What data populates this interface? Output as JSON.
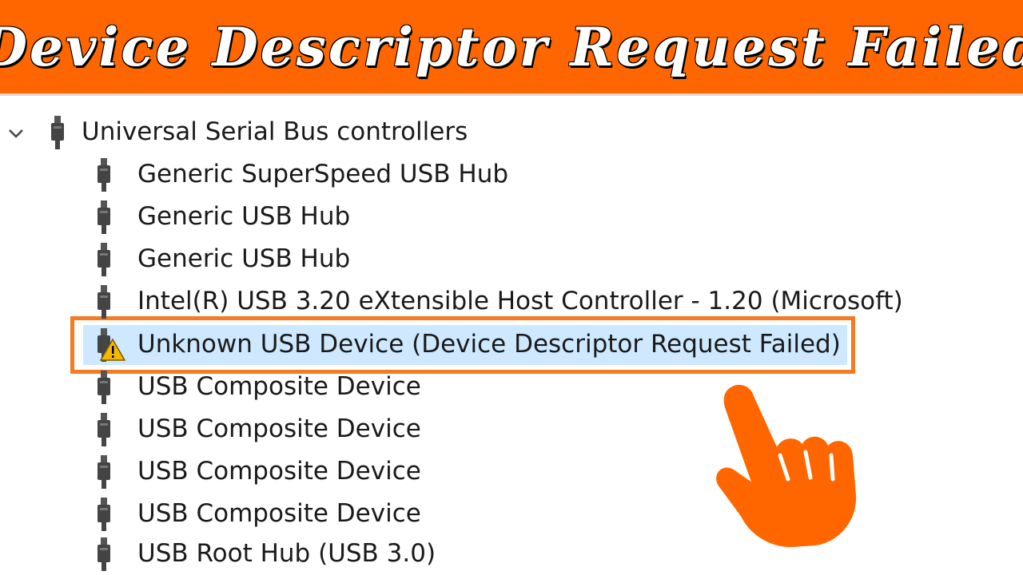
{
  "banner": {
    "title": "Device Descriptor Request Failed"
  },
  "tree": {
    "category": {
      "label": "Universal Serial Bus controllers",
      "expanded": true,
      "icon": "usb-plug-icon"
    },
    "items": [
      {
        "label": "Generic SuperSpeed USB Hub",
        "icon": "usb-plug-icon"
      },
      {
        "label": "Generic USB Hub",
        "icon": "usb-plug-icon"
      },
      {
        "label": "Generic USB Hub",
        "icon": "usb-plug-icon"
      },
      {
        "label": "Intel(R) USB 3.20 eXtensible Host Controller - 1.20 (Microsoft)",
        "icon": "usb-plug-icon"
      },
      {
        "label": "Unknown USB Device (Device Descriptor Request Failed)",
        "icon": "usb-warning-icon",
        "selected": true
      },
      {
        "label": "USB Composite Device",
        "icon": "usb-plug-icon"
      },
      {
        "label": "USB Composite Device",
        "icon": "usb-plug-icon"
      },
      {
        "label": "USB Composite Device",
        "icon": "usb-plug-icon"
      },
      {
        "label": "USB Composite Device",
        "icon": "usb-plug-icon"
      },
      {
        "label": "USB Root Hub (USB 3.0)",
        "icon": "usb-plug-icon"
      }
    ]
  },
  "colors": {
    "accent": "#ff6600",
    "highlight_border": "#f47b20",
    "selection": "#cde8ff",
    "warning": "#f5b800"
  }
}
